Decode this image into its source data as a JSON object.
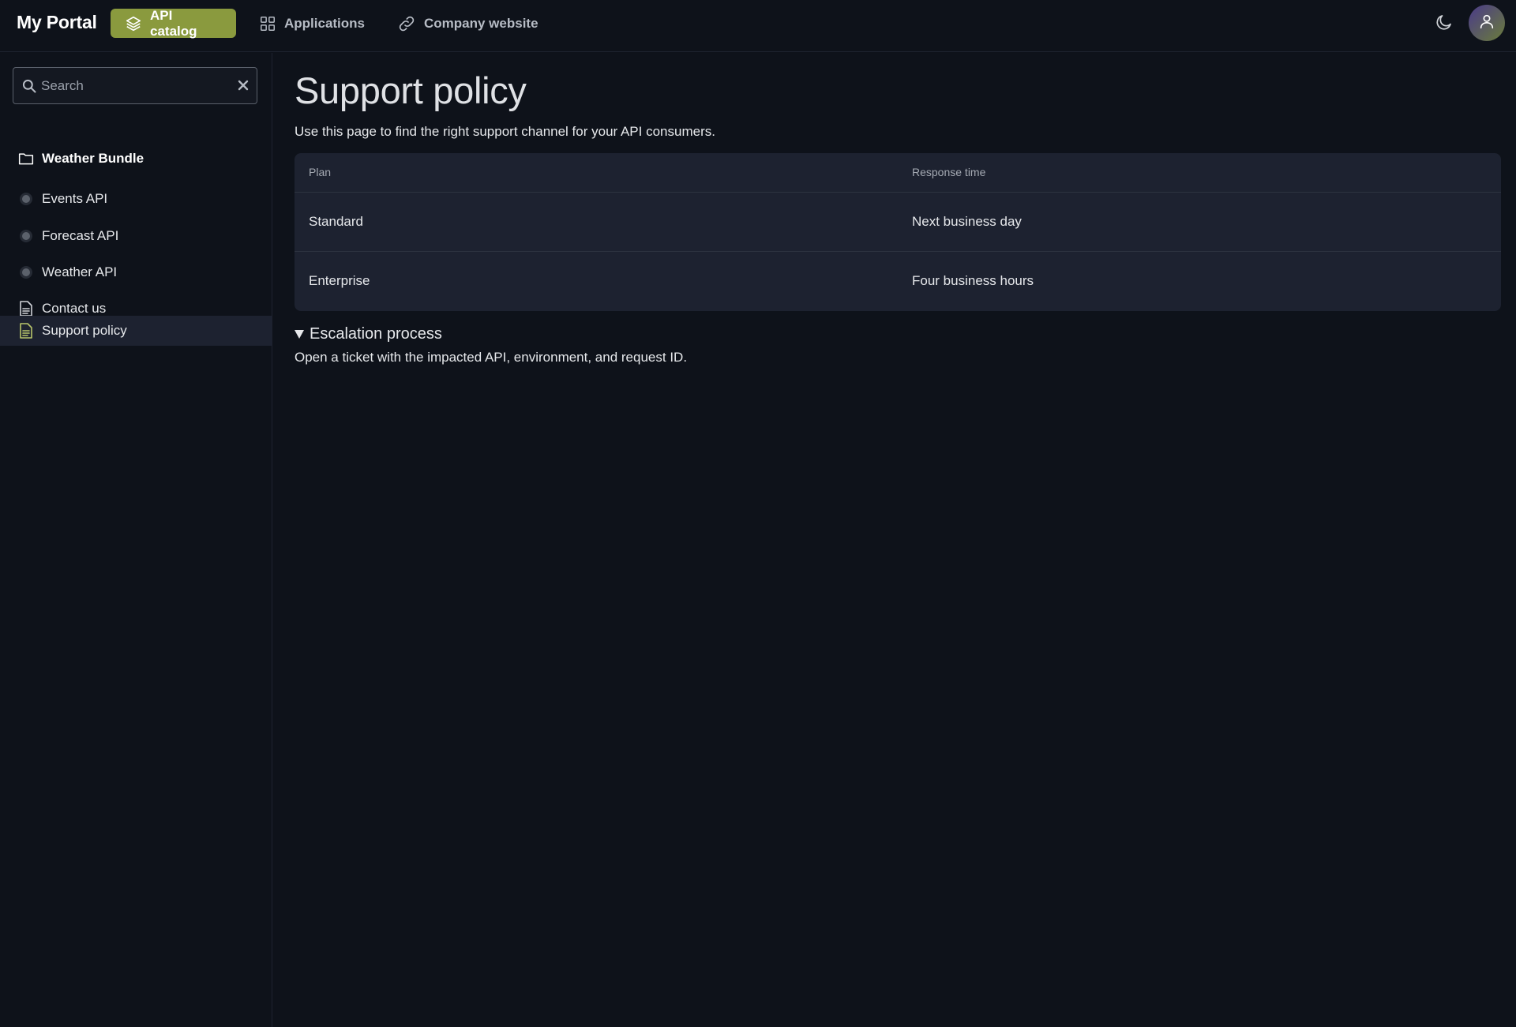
{
  "header": {
    "brand": "My Portal",
    "nav": [
      {
        "label": "API catalog",
        "icon": "layers-icon",
        "active": true
      },
      {
        "label": "Applications",
        "icon": "grid-icon",
        "active": false
      },
      {
        "label": "Company website",
        "icon": "link-icon",
        "active": false
      }
    ],
    "theme_toggle_icon": "moon-icon",
    "avatar_icon": "user-icon"
  },
  "sidebar": {
    "search": {
      "placeholder": "Search",
      "value": ""
    },
    "items": [
      {
        "label": "Weather Bundle",
        "icon": "folder-icon"
      },
      {
        "label": "Events API",
        "icon": "dot-icon"
      },
      {
        "label": "Forecast API",
        "icon": "dot-icon"
      },
      {
        "label": "Weather API",
        "icon": "dot-icon"
      },
      {
        "label": "Contact us",
        "icon": "document-icon"
      },
      {
        "label": "Support policy",
        "icon": "document-icon",
        "selected": true
      }
    ]
  },
  "main": {
    "title": "Support policy",
    "intro": "Use this page to find the right support channel for your API consumers.",
    "table": {
      "headers": [
        "Plan",
        "Response time"
      ],
      "rows": [
        [
          "Standard",
          "Next business day"
        ],
        [
          "Enterprise",
          "Four business hours"
        ]
      ]
    },
    "details": {
      "summary": "Escalation process",
      "body": "Open a ticket with the impacted API, environment, and request ID."
    }
  },
  "colors": {
    "background": "#0e121a",
    "accent": "#8a9a3e",
    "surface": "#1d2230",
    "border": "#1e2330"
  }
}
